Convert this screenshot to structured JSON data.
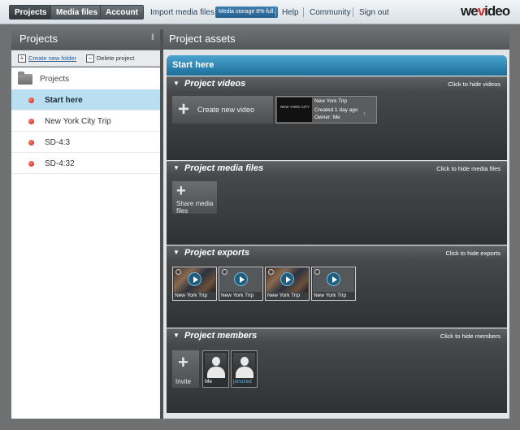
{
  "topbar": {
    "tabs": [
      {
        "label": "Projects",
        "active": true
      },
      {
        "label": "Media files",
        "active": false
      },
      {
        "label": "Account",
        "active": false
      }
    ],
    "import_label": "Import media files",
    "storage_label": "Media storage 8% full.",
    "links": [
      "Help",
      "Community",
      "Sign out"
    ],
    "logo_prefix": "we",
    "logo_accent": "v",
    "logo_suffix": "ideo"
  },
  "left": {
    "title": "Projects",
    "toolbar": {
      "create_folder": "Create new folder",
      "delete_project": "Delete project"
    },
    "root_label": "Projects",
    "projects": [
      {
        "label": "Start here",
        "selected": true
      },
      {
        "label": "New York City Trip",
        "selected": false
      },
      {
        "label": "SD-4:3",
        "selected": false
      },
      {
        "label": "SD-4:32",
        "selected": false
      }
    ]
  },
  "right": {
    "title": "Project assets",
    "project_name": "Start here",
    "sections": {
      "videos": {
        "title": "Project videos",
        "hide_label": "Click to hide videos"
      },
      "media": {
        "title": "Project media files",
        "hide_label": "Click to hide media files"
      },
      "exports": {
        "title": "Project exports",
        "hide_label": "Click to hide exports"
      },
      "members": {
        "title": "Project members",
        "hide_label": "Click to hide members"
      }
    },
    "create_video_label": "Create new video",
    "video": {
      "thumb_text": "NEW YORK CITY",
      "title": "New York Trip",
      "created": "Created 1 day ago",
      "owner": "Owner: Me"
    },
    "share_label": "Share media files",
    "exports": [
      {
        "label": "New York Trip",
        "thumb": "crowd"
      },
      {
        "label": "New York Trip",
        "thumb": "plain"
      },
      {
        "label": "New York Trip",
        "thumb": "crowd"
      },
      {
        "label": "New York Trip",
        "thumb": "plain"
      }
    ],
    "invite_label": "Invite",
    "members": [
      {
        "label": "Me"
      },
      {
        "label": "jonozed"
      }
    ]
  },
  "colors": {
    "accent_blue": "#1b6f99",
    "selected_row": "#b9dff0",
    "status_red": "#c0261a"
  },
  "icons": [
    "plus-icon",
    "folder-icon",
    "play-icon",
    "avatar-icon",
    "triangle-down-icon",
    "chevron-left-icon"
  ]
}
